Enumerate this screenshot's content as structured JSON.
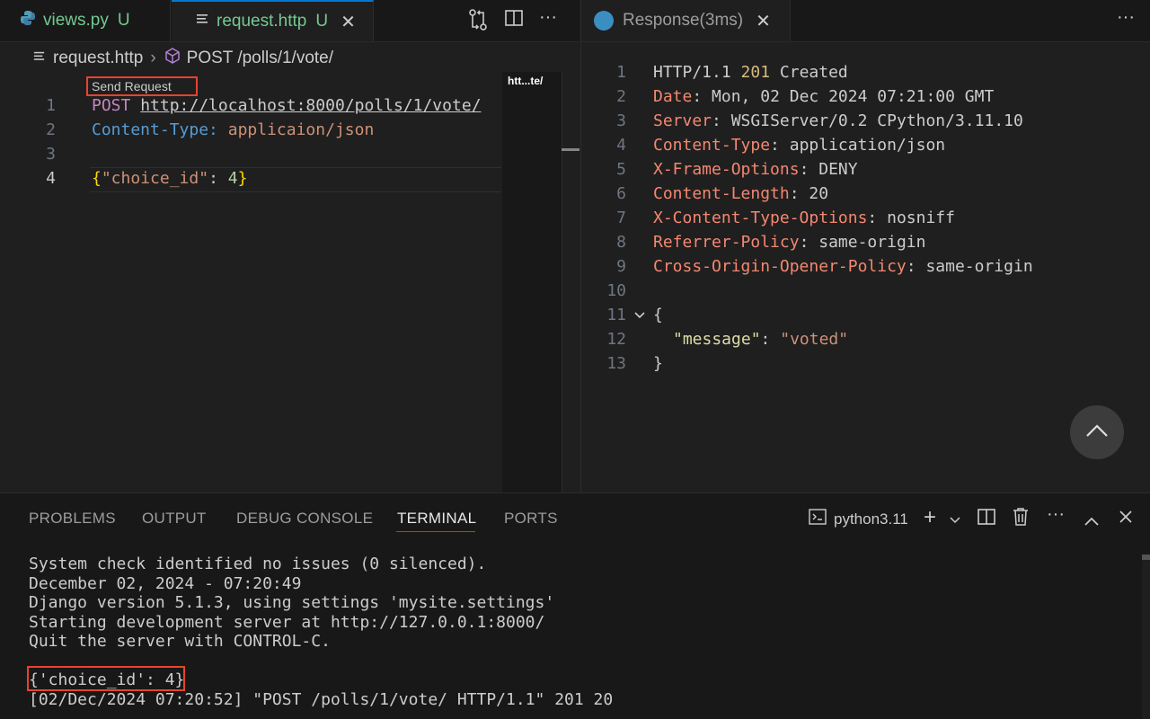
{
  "left_editor": {
    "tabs": [
      {
        "name": "views.py",
        "badge": "U",
        "icon": "python-icon"
      },
      {
        "name": "request.http",
        "badge": "U",
        "icon": "lines-icon",
        "active": true
      }
    ],
    "breadcrumb": [
      "request.http",
      "POST /polls/1/vote/"
    ],
    "codelens": "Send Request",
    "minimap_label": "htt...te/",
    "line_numbers": [
      "1",
      "2",
      "3",
      "4"
    ],
    "lines": {
      "l1_method": "POST",
      "l1_url": "http://localhost:8000/polls/1/vote/",
      "l2_name": "Content-Type:",
      "l2_value": "applicaion/json",
      "l4_open": "{",
      "l4_key": "\"choice_id\"",
      "l4_colon": ": ",
      "l4_value": "4",
      "l4_close": "}"
    }
  },
  "right_editor": {
    "tab_title": "Response(3ms)",
    "line_numbers": [
      "1",
      "2",
      "3",
      "4",
      "5",
      "6",
      "7",
      "8",
      "9",
      "10",
      "11",
      "12",
      "13"
    ],
    "status": {
      "proto": "HTTP/1.1 ",
      "code": "201",
      "text": " Created"
    },
    "headers": [
      {
        "name": "Date",
        "value": "Mon, 02 Dec 2024 07:21:00 GMT"
      },
      {
        "name": "Server",
        "value": "WSGIServer/0.2 CPython/3.11.10"
      },
      {
        "name": "Content-Type",
        "value": "application/json"
      },
      {
        "name": "X-Frame-Options",
        "value": "DENY"
      },
      {
        "name": "Content-Length",
        "value": "20"
      },
      {
        "name": "X-Content-Type-Options",
        "value": "nosniff"
      },
      {
        "name": "Referrer-Policy",
        "value": "same-origin"
      },
      {
        "name": "Cross-Origin-Opener-Policy",
        "value": "same-origin"
      }
    ],
    "separator": ": ",
    "body": {
      "open": "{",
      "key": "\"message\"",
      "colon": ": ",
      "value": "\"voted\"",
      "close": "}"
    }
  },
  "panel": {
    "tabs": [
      "PROBLEMS",
      "OUTPUT",
      "DEBUG CONSOLE",
      "TERMINAL",
      "PORTS"
    ],
    "active_tab": "TERMINAL",
    "terminal_name": "python3.11",
    "lines": [
      "System check identified no issues (0 silenced).",
      "December 02, 2024 - 07:20:49",
      "Django version 5.1.3, using settings 'mysite.settings'",
      "Starting development server at http://127.0.0.1:8000/",
      "Quit the server with CONTROL-C.",
      "",
      "{'choice_id': 4}",
      "[02/Dec/2024 07:20:52] \"POST /polls/1/vote/ HTTP/1.1\" 201 20"
    ]
  },
  "colors": {
    "accent": "#0078d4",
    "highlight_box": "#e8432d",
    "untracked": "#73c991"
  }
}
